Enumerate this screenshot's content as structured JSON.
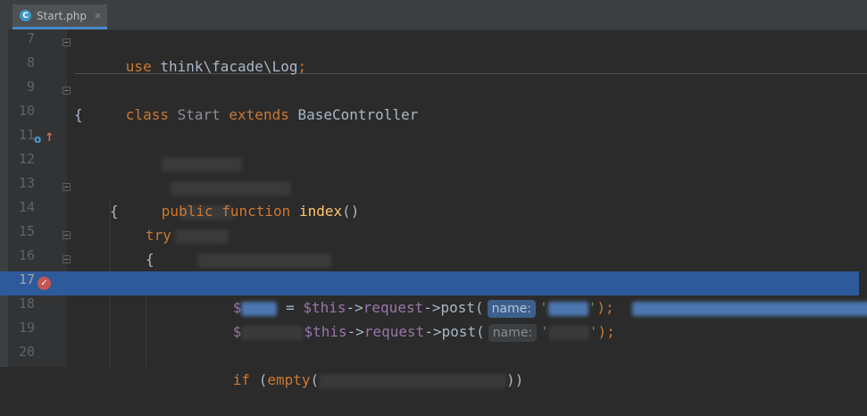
{
  "tab": {
    "label": "Start.php",
    "icon": "C",
    "close": "×"
  },
  "lines": [
    {
      "num": "7"
    },
    {
      "num": "8"
    },
    {
      "num": "9"
    },
    {
      "num": "10"
    },
    {
      "num": "11"
    },
    {
      "num": "12"
    },
    {
      "num": "13"
    },
    {
      "num": "14"
    },
    {
      "num": "15"
    },
    {
      "num": "16"
    },
    {
      "num": "17"
    },
    {
      "num": "18"
    },
    {
      "num": "19"
    },
    {
      "num": "20"
    }
  ],
  "code": {
    "l7_use": "use",
    "l7_rest": " think\\facade\\Log",
    "l7_semi": ";",
    "l9_class": "class",
    "l9_name": " Start ",
    "l9_extends": "extends",
    "l9_parent": " BaseController",
    "l10": "{",
    "l13_public": "public",
    "l13_function": "function",
    "l13_name": "index",
    "l13_parens": "()",
    "l14": "{",
    "l15_try": "try",
    "l16": "{",
    "l17_dollar": "$",
    "l17_eq": " = ",
    "l17_this": "$this",
    "l17_arrow1": "->",
    "l17_request": "request",
    "l17_arrow2": "->",
    "l17_post": "post",
    "l17_open": "(",
    "l17_hint": "name:",
    "l17_q1": "'",
    "l17_q2": "'",
    "l17_close": ");",
    "l18_dollar": "$",
    "l18_this": "$this",
    "l18_arrow1": "->",
    "l18_request": "request",
    "l18_arrow2": "->",
    "l18_post": "post",
    "l18_open": "(",
    "l18_hint": "name:",
    "l18_q1": "'",
    "l18_q2": "'",
    "l18_close": ");",
    "l20_if": "if",
    "l20_open": " (",
    "l20_empty": "empty",
    "l20_paren": "(",
    "l20_close": "))"
  }
}
